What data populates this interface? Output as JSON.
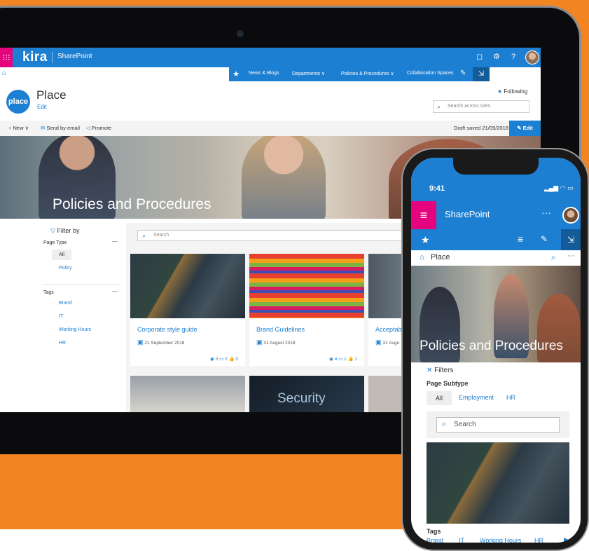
{
  "desktop": {
    "brand": "kira",
    "app_name": "SharePoint",
    "nav": {
      "items": [
        "News & Blogs",
        "Departments",
        "Policies & Procedures",
        "Collaboration Spaces"
      ]
    },
    "site": {
      "logo_text": "place",
      "title": "Place",
      "edit_link": "Edit",
      "following": "Following",
      "search_placeholder": "Search across sites"
    },
    "commands": {
      "new": "New",
      "send_by_email": "Send by email",
      "promote": "Promote",
      "draft_status": "Draft saved 21/09/2018",
      "edit": "Edit"
    },
    "hero_title": "Policies and Procedures",
    "filters": {
      "title": "Filter by",
      "page_type_label": "Page Type",
      "page_type_options": [
        "All",
        "Policy"
      ],
      "tags_label": "Tags",
      "tags": [
        "Brand",
        "IT",
        "Working Hours",
        "HR"
      ]
    },
    "search_placeholder": "Search",
    "cards": [
      {
        "title": "Corporate style guide",
        "date": "21 September 2018",
        "views": "0",
        "comments": "0",
        "likes": "0"
      },
      {
        "title": "Brand Guidelines",
        "date": "31 August 2018",
        "views": "4",
        "comments": "1",
        "likes": "1"
      },
      {
        "title": "Acceptab",
        "date": "31 Augu"
      }
    ],
    "row2_text": "Security"
  },
  "mobile": {
    "time": "9:41",
    "app_name": "SharePoint",
    "site_title": "Place",
    "hero_title": "Policies and Procedures",
    "filters_label": "Filters",
    "page_subtype_label": "Page Subtype",
    "subtypes": [
      "All",
      "Employment",
      "HR"
    ],
    "search_placeholder": "Search",
    "tags_label": "Tags",
    "tags": [
      "Brand",
      "IT",
      "Working Hours",
      "HR"
    ]
  },
  "colors": {
    "background": "#f28522",
    "accent": "#1d7fd1",
    "brand_magenta": "#e5047e"
  }
}
